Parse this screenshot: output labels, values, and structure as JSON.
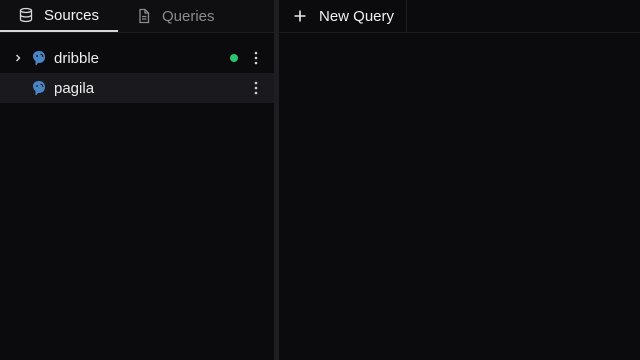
{
  "sidebar": {
    "tabs": [
      {
        "label": "Sources",
        "icon": "database-icon",
        "active": true
      },
      {
        "label": "Queries",
        "icon": "document-icon",
        "active": false
      }
    ],
    "sources": [
      {
        "label": "dribble",
        "connected": true,
        "expandable": true
      },
      {
        "label": "pagila",
        "connected": false,
        "expandable": false,
        "selected": true
      }
    ]
  },
  "editor": {
    "new_query_label": "New Query"
  },
  "colors": {
    "connected": "#28c76f",
    "postgres_icon": "#4a86c5"
  }
}
